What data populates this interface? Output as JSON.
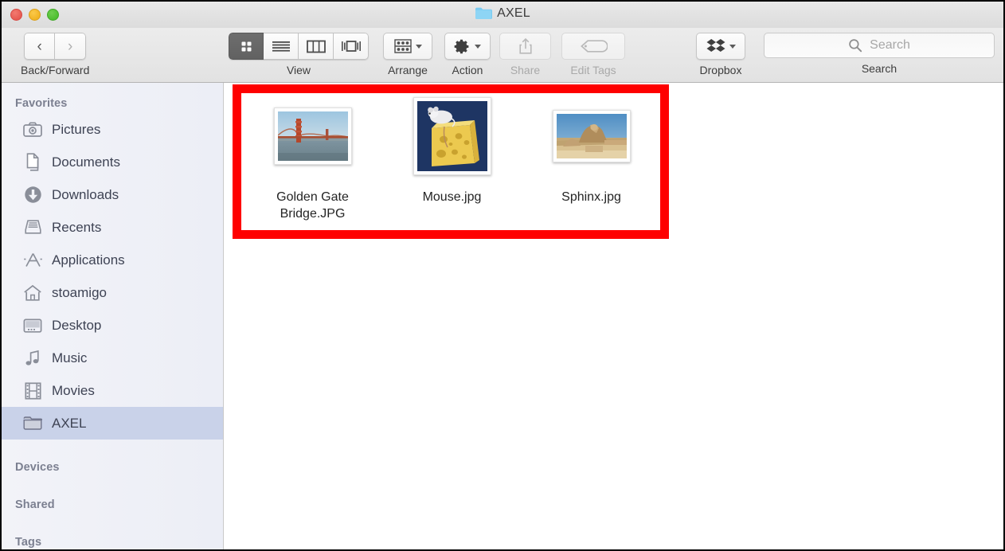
{
  "window": {
    "title": "AXEL",
    "title_icon": "folder-icon",
    "traffic_lights": [
      {
        "name": "close",
        "color": "#e75a52"
      },
      {
        "name": "minimize",
        "color": "#f1b424"
      },
      {
        "name": "maximize",
        "color": "#4fbf32"
      }
    ]
  },
  "toolbar": {
    "nav": {
      "caption": "Back/Forward",
      "back_icon": "chevron-left-icon",
      "forward_icon": "chevron-right-icon"
    },
    "view": {
      "caption": "View",
      "options": [
        {
          "name": "icon-view",
          "icon": "grid-icon",
          "active": true
        },
        {
          "name": "list-view",
          "icon": "list-icon",
          "active": false
        },
        {
          "name": "column-view",
          "icon": "columns-icon",
          "active": false
        },
        {
          "name": "gallery-view",
          "icon": "coverflow-icon",
          "active": false
        }
      ]
    },
    "arrange": {
      "caption": "Arrange",
      "icon": "arrange-grid-icon",
      "disabled": false
    },
    "action": {
      "caption": "Action",
      "icon": "gear-icon",
      "disabled": false
    },
    "share": {
      "caption": "Share",
      "icon": "share-icon",
      "disabled": true
    },
    "edit_tags": {
      "caption": "Edit Tags",
      "icon": "tag-icon",
      "disabled": true
    },
    "dropbox": {
      "caption": "Dropbox",
      "icon": "dropbox-icon",
      "disabled": false
    },
    "search": {
      "caption": "Search",
      "placeholder": "Search",
      "value": "",
      "icon": "search-icon"
    }
  },
  "sidebar": {
    "sections": [
      {
        "header": "Favorites",
        "items": [
          {
            "label": "Pictures",
            "icon": "camera-icon",
            "selected": false
          },
          {
            "label": "Documents",
            "icon": "documents-icon",
            "selected": false
          },
          {
            "label": "Downloads",
            "icon": "download-icon",
            "selected": false
          },
          {
            "label": "Recents",
            "icon": "recents-icon",
            "selected": false
          },
          {
            "label": "Applications",
            "icon": "applications-icon",
            "selected": false
          },
          {
            "label": "stoamigo",
            "icon": "home-icon",
            "selected": false
          },
          {
            "label": "Desktop",
            "icon": "desktop-icon",
            "selected": false
          },
          {
            "label": "Music",
            "icon": "music-note-icon",
            "selected": false
          },
          {
            "label": "Movies",
            "icon": "film-icon",
            "selected": false
          },
          {
            "label": "AXEL",
            "icon": "folder-icon",
            "selected": true
          }
        ]
      },
      {
        "header": "Devices",
        "items": []
      },
      {
        "header": "Shared",
        "items": []
      },
      {
        "header": "Tags",
        "items": []
      }
    ]
  },
  "content": {
    "files": [
      {
        "name": "Golden Gate Bridge.JPG",
        "thumbnail": "golden-gate-bridge-photo",
        "orientation": "landscape"
      },
      {
        "name": "Mouse.jpg",
        "thumbnail": "mouse-on-cheese-photo",
        "orientation": "square"
      },
      {
        "name": "Sphinx.jpg",
        "thumbnail": "sphinx-photo",
        "orientation": "landscape"
      }
    ]
  },
  "annotation": {
    "highlight_color": "#fe0000",
    "target": "file-icon-grid"
  }
}
